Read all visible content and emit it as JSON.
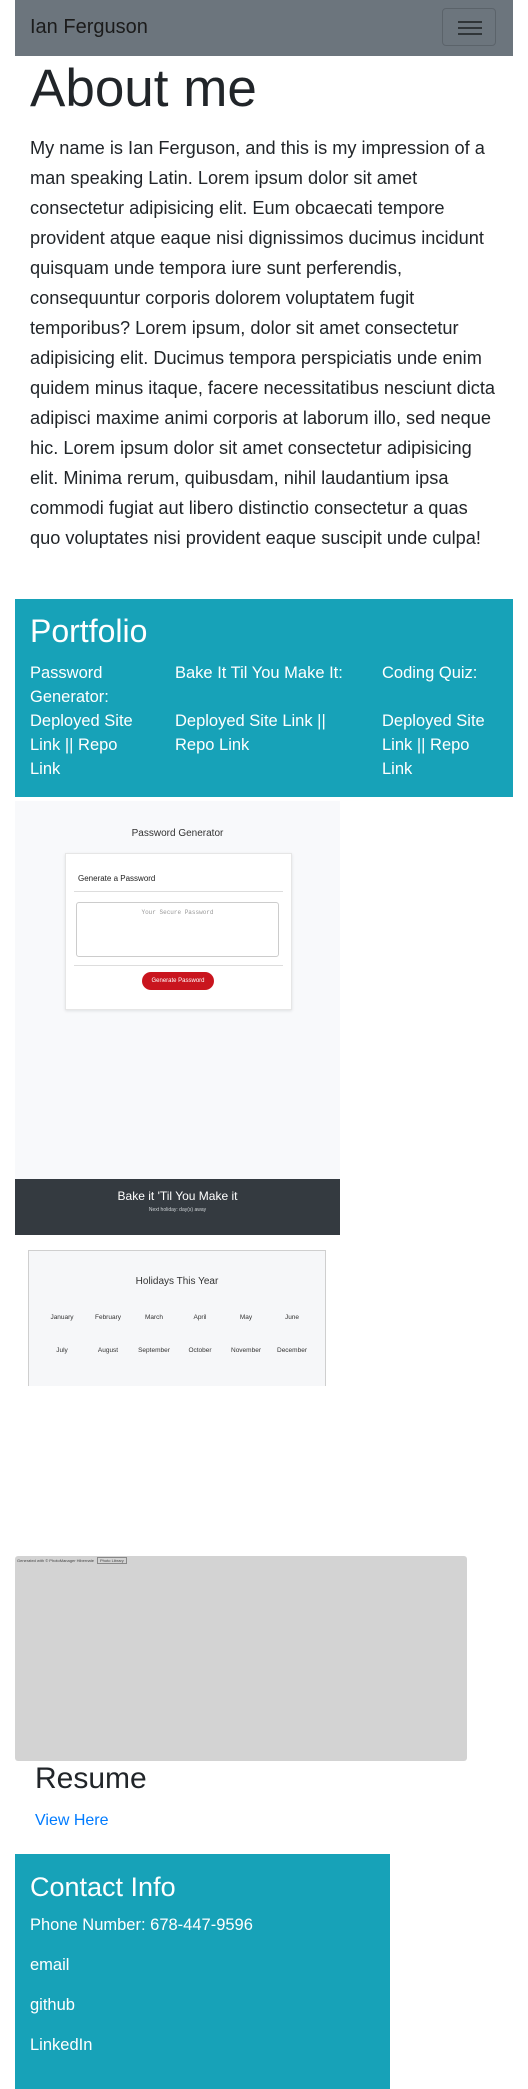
{
  "navbar": {
    "brand": "Ian Ferguson"
  },
  "about": {
    "title": "About me",
    "text": "My name is Ian Ferguson, and this is my impression of a man speaking Latin. Lorem ipsum dolor sit amet consectetur adipisicing elit. Eum obcaecati tempore provident atque eaque nisi dignissimos ducimus incidunt quisquam unde tempora iure sunt perferendis, consequuntur corporis dolorem voluptatem fugit temporibus? Lorem ipsum, dolor sit amet consectetur adipisicing elit. Ducimus tempora perspiciatis unde enim quidem minus itaque, facere necessitatibus nesciunt dicta adipisci maxime animi corporis at laborum illo, sed neque hic. Lorem ipsum dolor sit amet consectetur adipisicing elit. Minima rerum, quibusdam, nihil laudantium ipsa commodi fugiat aut libero distinctio consectetur a quas quo voluptates nisi provident eaque suscipit unde culpa!"
  },
  "portfolio": {
    "title": "Portfolio",
    "projects": [
      {
        "title": "Password Generator:",
        "deployed": "Deployed Site Link",
        "sep": " || ",
        "repo": "Repo Link"
      },
      {
        "title": "Bake It Til You Make It:",
        "deployed": "Deployed Site Link",
        "sep": " || ",
        "repo": "Repo Link"
      },
      {
        "title": "Coding Quiz:",
        "deployed": "Deployed Site Link",
        "sep": " || ",
        "repo": "Repo Link"
      }
    ]
  },
  "screenshots": {
    "password_generator": {
      "heading": "Password Generator",
      "card_title": "Generate a Password",
      "placeholder": "Your Secure Password",
      "button": "Generate Password"
    },
    "bake": {
      "title": "Bake it 'Til You Make it",
      "subtitle": "Next holiday: day(s) away"
    },
    "holidays": {
      "title": "Holidays This Year",
      "row1": [
        "January",
        "February",
        "March",
        "April",
        "May",
        "June"
      ],
      "row2": [
        "July",
        "August",
        "September",
        "October",
        "November",
        "December"
      ]
    },
    "quiz": {
      "error_text": "Generated with © PhotoManager Hibernate",
      "error_button": "Photo Library"
    }
  },
  "resume": {
    "title": "Resume",
    "link": "View Here"
  },
  "contact": {
    "title": "Contact Info",
    "phone": "Phone Number: 678-447-9596",
    "email": "email",
    "github": "github",
    "linkedin": "LinkedIn"
  },
  "colors": {
    "navbar": "#6c757d",
    "section": "#17a2b8",
    "link": "#007bff",
    "bake_bar": "#343a40",
    "generate_button": "#c9151e"
  }
}
